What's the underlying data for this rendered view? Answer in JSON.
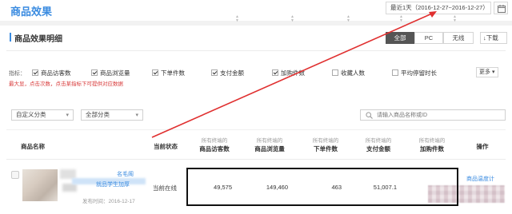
{
  "header": {
    "title": "商品效果",
    "date_range": "最近1天（2016-12-27~2016-12-27）"
  },
  "section": {
    "title": "商品效果明细",
    "segments": [
      "全部",
      "PC",
      "无线"
    ],
    "active_segment": "全部",
    "download_label": "↓下载"
  },
  "metrics": {
    "label": "指标：",
    "items": [
      {
        "label": "商品访客数",
        "checked": true
      },
      {
        "label": "商品浏览量",
        "checked": true
      },
      {
        "label": "下单件数",
        "checked": true
      },
      {
        "label": "支付金额",
        "checked": true
      },
      {
        "label": "加购件数",
        "checked": true
      },
      {
        "label": "收藏人数",
        "checked": false
      },
      {
        "label": "平均停留时长",
        "checked": false
      }
    ],
    "hint": "最大显，点击次数，点击某指标下可提供对应数据",
    "more_label": "更多"
  },
  "filters": {
    "category1": "自定义分类",
    "category2": "全部分类",
    "search_placeholder": "请输入商品名称或ID"
  },
  "table": {
    "columns": [
      {
        "sub": "",
        "main": "商品名称"
      },
      {
        "sub": "",
        "main": "当前状态"
      },
      {
        "sub": "所有终端的",
        "main": "商品访客数"
      },
      {
        "sub": "所有终端的",
        "main": "商品浏览量"
      },
      {
        "sub": "所有终端的",
        "main": "下单件数"
      },
      {
        "sub": "所有终端的",
        "main": "支付金额"
      },
      {
        "sub": "所有终端的",
        "main": "加购件数"
      },
      {
        "sub": "",
        "main": "操作"
      }
    ],
    "rows": [
      {
        "name_line1": "名毛阁",
        "name_line2": "就品学生加厚",
        "publish": "发布时间：2016-12-17",
        "status": "当前在线",
        "visitors": "49,575",
        "pageviews": "149,460",
        "orders": "463",
        "payment": "51,007.1",
        "carts": "",
        "action": "商品温度计"
      }
    ]
  },
  "colors": {
    "accent": "#3a8be0",
    "annotation": "#e03030",
    "highlight_border": "#111111"
  }
}
